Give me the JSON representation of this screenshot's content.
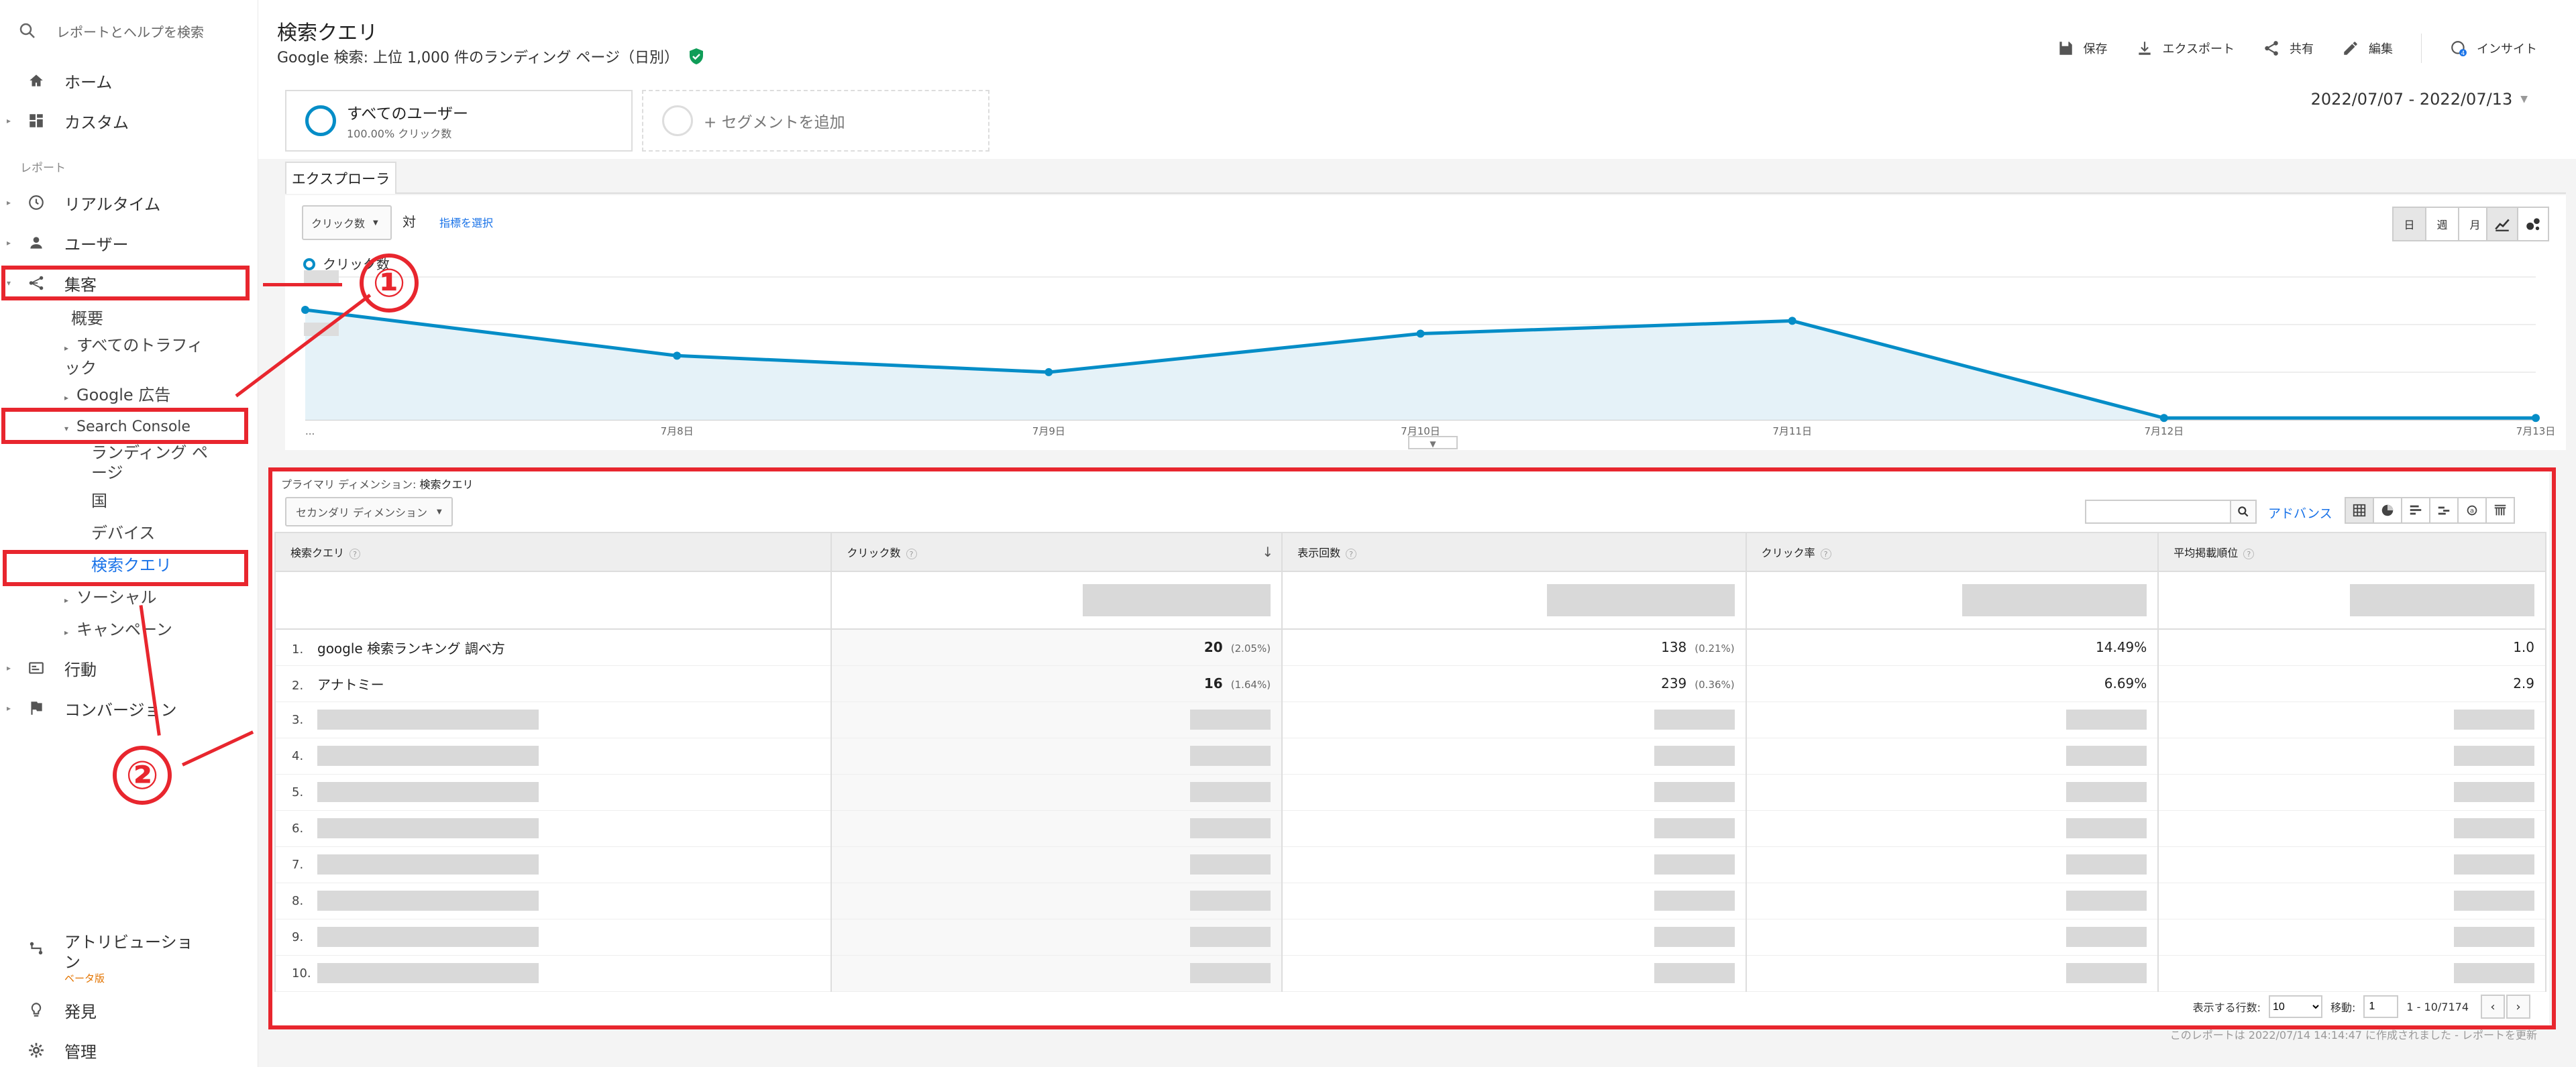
{
  "sidebar": {
    "search_placeholder": "レポートとヘルプを検索",
    "home": "ホーム",
    "custom": "カスタム",
    "reports_label": "レポート",
    "realtime": "リアルタイム",
    "user": "ユーザー",
    "acquisition": "集客",
    "overview": "概要",
    "all_traffic": "すべてのトラフィック",
    "google_ads": "Google 広告",
    "search_console": "Search Console",
    "landing_pages": "ランディング ページ",
    "country": "国",
    "device": "デバイス",
    "queries": "検索クエリ",
    "social": "ソーシャル",
    "campaign": "キャンペーン",
    "behavior": "行動",
    "conversion": "コンバージョン",
    "attribution": "アトリビューション",
    "beta": "ベータ版",
    "discover": "発見",
    "admin": "管理"
  },
  "header": {
    "title": "検索クエリ",
    "subtitle": "Google 検索: 上位 1,000 件のランディング ページ（日別）",
    "save": "保存",
    "export": "エクスポート",
    "share": "共有",
    "edit": "編集",
    "insight": "インサイト"
  },
  "segments": {
    "primary_name": "すべてのユーザー",
    "primary_pct": "100.00% クリック数",
    "add": "+ セグメントを追加"
  },
  "date_range": "2022/07/07 - 2022/07/13",
  "tab": "エクスプローラ",
  "chart_controls": {
    "metric": "クリック数",
    "vs": "対",
    "pick_metric": "指標を選択",
    "day": "日",
    "week": "週",
    "month": "月"
  },
  "chart_data": {
    "type": "area",
    "categories": [
      "...",
      "7月8日",
      "7月9日",
      "7月10日",
      "7月11日",
      "7月12日",
      "7月13日"
    ],
    "series": [
      {
        "name": "クリック数",
        "values": [
          6,
          3.5,
          2.6,
          4.7,
          5.4,
          0.1,
          0.1
        ]
      }
    ],
    "ylim": [
      0,
      7.5
    ],
    "grid": true,
    "legend": "top-left",
    "color": "#058dc7"
  },
  "table": {
    "primary_dimension_label": "プライマリ ディメンション:",
    "primary_dimension_value": "検索クエリ",
    "secondary_dimension": "セカンダリ ディメンション",
    "advance": "アドバンス",
    "columns": [
      "検索クエリ",
      "クリック数",
      "表示回数",
      "クリック率",
      "平均掲載順位"
    ],
    "rows": [
      {
        "idx": "1.",
        "query": "google 検索ランキング 調べ方",
        "clicks": "20",
        "clicks_pct": "(2.05%)",
        "impressions": "138",
        "impressions_pct": "(0.21%)",
        "ctr": "14.49%",
        "position": "1.0"
      },
      {
        "idx": "2.",
        "query": "アナトミー",
        "clicks": "16",
        "clicks_pct": "(1.64%)",
        "impressions": "239",
        "impressions_pct": "(0.36%)",
        "ctr": "6.69%",
        "position": "2.9"
      },
      {
        "idx": "3."
      },
      {
        "idx": "4."
      },
      {
        "idx": "5."
      },
      {
        "idx": "6."
      },
      {
        "idx": "7."
      },
      {
        "idx": "8."
      },
      {
        "idx": "9."
      },
      {
        "idx": "10."
      }
    ]
  },
  "pager": {
    "rows_label": "表示する行数:",
    "rows_value": "10",
    "goto_label": "移動:",
    "goto_value": "1",
    "range": "1 - 10/7174"
  },
  "footer_note": "このレポートは 2022/07/14 14:14:47 に作成されました - レポートを更新",
  "annotations": {
    "one": "①",
    "two": "②"
  },
  "colors": {
    "accent": "#058dc7",
    "annotation": "#e8262e",
    "link": "#1a73e8"
  }
}
